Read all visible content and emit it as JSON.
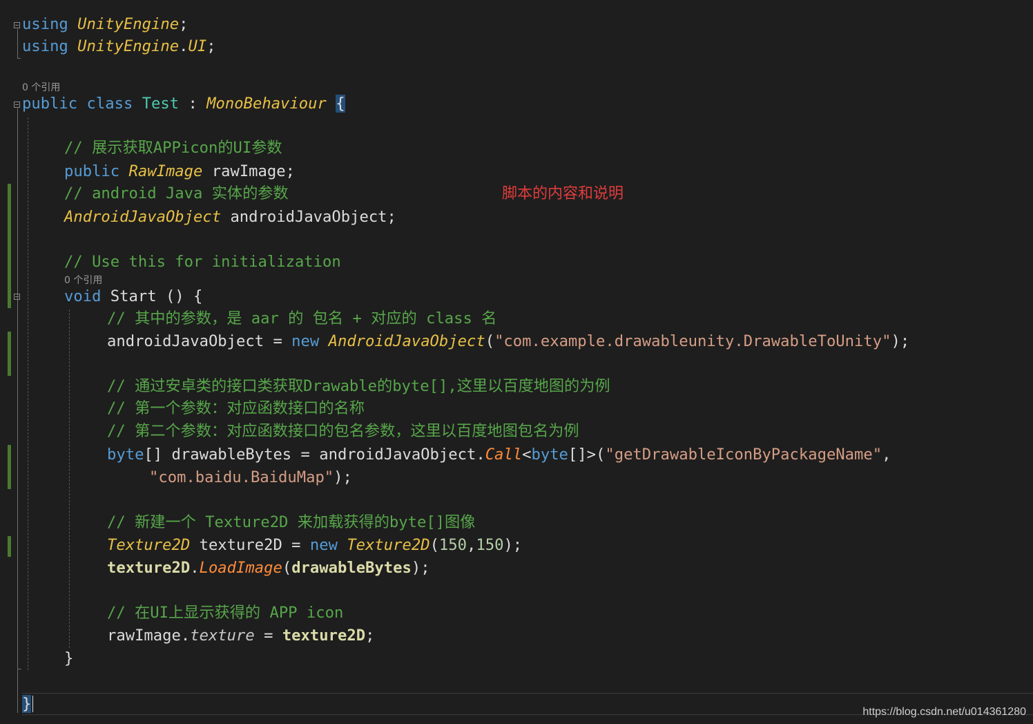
{
  "annotation": "脚本的内容和说明",
  "watermark": "https://blog.csdn.net/u014361280",
  "hints": {
    "class_refs": "0 个引用",
    "method_refs": "0 个引用"
  },
  "code": {
    "l1": {
      "kw": "using",
      "ns": "UnityEngine",
      "end": ";"
    },
    "l2": {
      "kw": "using",
      "ns": "UnityEngine",
      "dot": ".",
      "ns2": "UI",
      "end": ";"
    },
    "l3": {
      "kw1": "public",
      "kw2": "class",
      "name": "Test",
      "colon": " : ",
      "base": "MonoBehaviour",
      "brace": "{"
    },
    "l4": {
      "cmt": "// 展示获取APPicon的UI参数"
    },
    "l5": {
      "kw": "public",
      "type": "RawImage",
      "rest": " rawImage;"
    },
    "l6": {
      "cmt": "// android Java 实体的参数"
    },
    "l7": {
      "type": "AndroidJavaObject",
      "rest": " androidJavaObject;"
    },
    "l8": {
      "cmt": "// Use this for initialization"
    },
    "l9": {
      "kw": "void",
      "rest": " Start () {"
    },
    "l10": {
      "cmt": "// 其中的参数，是 aar 的 包名 + 对应的 class 名"
    },
    "l11": {
      "a": "androidJavaObject = ",
      "kw": "new",
      "type": "AndroidJavaObject",
      "p1": "(",
      "str": "\"com.example.drawableunity.DrawableToUnity\"",
      "p2": ");"
    },
    "l12": {
      "cmt": "// 通过安卓类的接口类获取Drawable的byte[],这里以百度地图的为例"
    },
    "l13": {
      "cmt": "// 第一个参数：对应函数接口的名称"
    },
    "l14": {
      "cmt": "// 第二个参数：对应函数接口的包名参数，这里以百度地图包名为例"
    },
    "l15": {
      "kw": "byte",
      "a": "[] drawableBytes = androidJavaObject.",
      "meth": "Call",
      "lt": "<",
      "kw2": "byte",
      "gt": "[]>(",
      "str": "\"getDrawableIconByPackageName\"",
      "comma": ","
    },
    "l16": {
      "str": "\"com.baidu.BaiduMap\"",
      "end": ");"
    },
    "l17": {
      "cmt": "// 新建一个 Texture2D 来加载获得的byte[]图像"
    },
    "l18": {
      "type": "Texture2D",
      "a": " texture2D = ",
      "kw": "new",
      "type2": "Texture2D",
      "p1": "(",
      "n1": "150",
      "c": ",",
      "n2": "150",
      "p2": ");"
    },
    "l19": {
      "bold1": "texture2D",
      "dot": ".",
      "meth": "LoadImage",
      "p1": "(",
      "bold2": "drawableBytes",
      "p2": ");"
    },
    "l20": {
      "cmt": "// 在UI上显示获得的 APP icon"
    },
    "l21": {
      "a": "rawImage.",
      "prop": "texture",
      "eq": " = ",
      "bold": "texture2D",
      "end": ";"
    },
    "l22": {
      "brace": "}"
    },
    "l23": {
      "brace": "}"
    }
  }
}
